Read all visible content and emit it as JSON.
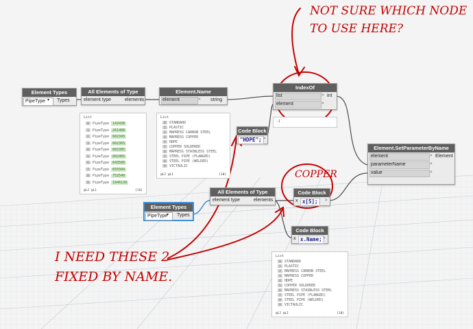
{
  "nodes": {
    "element_types_1": {
      "title": "Element Types",
      "dropdown": "PipeType",
      "output": "Types"
    },
    "all_elements_1": {
      "title": "All Elements of Type",
      "input": "element type",
      "output": "elements"
    },
    "element_name": {
      "title": "Element.Name",
      "input": "element",
      "output": "string"
    },
    "indexof": {
      "title": "IndexOf",
      "inputs": [
        "list",
        "element"
      ],
      "output": "int",
      "preview": "-1"
    },
    "code_block_1": {
      "title": "Code Block",
      "code": "\"HDPE\";"
    },
    "set_param": {
      "title": "Element.SetParameterByName",
      "inputs": [
        "element",
        "parameterName",
        "value"
      ],
      "output": "Element"
    },
    "element_types_2": {
      "title": "Element Types",
      "dropdown": "PipeType",
      "output": "Types"
    },
    "all_elements_2": {
      "title": "All Elements of Type",
      "input": "element type",
      "output": "elements"
    },
    "code_block_2": {
      "title": "Code Block",
      "code": "x[5];",
      "input": "x"
    },
    "code_block_3": {
      "title": "Code Block",
      "code": "x.Name;",
      "input": "x"
    }
  },
  "panels": {
    "pipetype_list": {
      "header": "List",
      "items": [
        {
          "i": "0",
          "label": "PipeType",
          "id": "142438"
        },
        {
          "i": "1",
          "label": "PipeType",
          "id": "261488"
        },
        {
          "i": "2",
          "label": "PipeType",
          "id": "602345"
        },
        {
          "i": "3",
          "label": "PipeType",
          "id": "602365"
        },
        {
          "i": "4",
          "label": "PipeType",
          "id": "602385"
        },
        {
          "i": "5",
          "label": "PipeType",
          "id": "602405"
        },
        {
          "i": "6",
          "label": "PipeType",
          "id": "643580"
        },
        {
          "i": "7",
          "label": "PipeType",
          "id": "655504"
        },
        {
          "i": "8",
          "label": "PipeType",
          "id": "752546"
        },
        {
          "i": "9",
          "label": "PipeType",
          "id": "1946139"
        }
      ],
      "footer": "@L2 @L1",
      "count": "{10}"
    },
    "names_list_1": {
      "header": "List",
      "items": [
        "STANDARD",
        "PLASTIC",
        "MAPRESS CARBON STEEL",
        "MAPRESS COPPER",
        "HDPE",
        "COPPER SOLDERED",
        "MAPRESS STAINLESS STEEL",
        "STEEL PIPE (FLANGED)",
        "STEEL PIPE (WELDED)",
        "VICTAULIC"
      ],
      "footer": "@L2 @L1",
      "count": "{10}"
    },
    "names_list_2": {
      "header": "List",
      "items": [
        "STANDARD",
        "PLASTIC",
        "MAPRESS CARBON STEEL",
        "MAPRESS COPPER",
        "HDPE",
        "COPPER SOLDERED",
        "MAPRESS STAINLESS STEEL",
        "STEEL PIPE (FLANGED)",
        "STEEL PIPE (WELDED)",
        "VICTAULIC"
      ],
      "footer": "@L2 @L1",
      "count": "{10}"
    }
  },
  "annotations": {
    "top_line1": "NOT SURE WHICH NODE",
    "top_line2": "TO USE HERE?",
    "copper": "COPPER",
    "bottom_line1": "I NEED THESE 2",
    "bottom_line2": "FIXED BY NAME."
  },
  "colors": {
    "annotation": "#c40000",
    "header": "#5f5f5f",
    "wire": "#4a4a4a",
    "selection": "#3d8fd6"
  }
}
